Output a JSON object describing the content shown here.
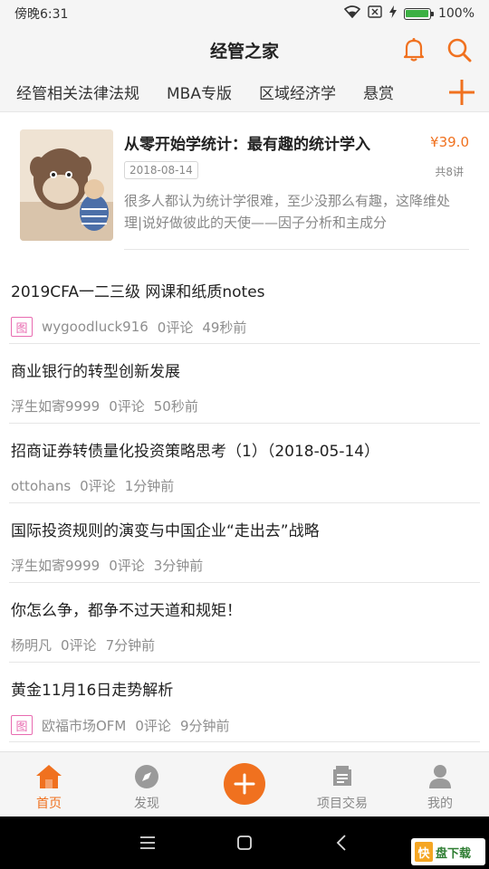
{
  "status_bar": {
    "time": "傍晚6:31",
    "battery": "100%",
    "battery_level": 1.0
  },
  "header": {
    "title": "经管之家",
    "icons": [
      "bell-icon",
      "search-icon"
    ]
  },
  "categories": {
    "items": [
      "经管相关法律法规",
      "MBA专版",
      "区域经济学",
      "悬赏"
    ],
    "add_icon": "plus-icon"
  },
  "featured_course": {
    "title": "从零开始学统计：最有趣的统计学入",
    "price": "¥39.0",
    "date": "2018-08-14",
    "lessons": "共8讲",
    "description": "很多人都认为统计学很难，至少没那么有趣，这降维处理|说好做彼此的天使——因子分析和主成分"
  },
  "articles": [
    {
      "title": "2019CFA一二三级 网课和纸质notes",
      "tag": "图",
      "author": "wygoodluck916",
      "comments": "0评论",
      "time": "49秒前"
    },
    {
      "title": "商业银行的转型创新发展",
      "tag": "",
      "author": "浮生如寄9999",
      "comments": "0评论",
      "time": "50秒前"
    },
    {
      "title": "招商证券转债量化投资策略思考（1）（2018-05-14）",
      "tag": "",
      "author": "ottohans",
      "comments": "0评论",
      "time": "1分钟前"
    },
    {
      "title": "国际投资规则的演变与中国企业“走出去”战略",
      "tag": "",
      "author": "浮生如寄9999",
      "comments": "0评论",
      "time": "3分钟前"
    },
    {
      "title": "你怎么争，都争不过天道和规矩！",
      "tag": "",
      "author": "杨明凡",
      "comments": "0评论",
      "time": "7分钟前"
    },
    {
      "title": "黄金11月16日走势解析",
      "tag": "图",
      "author": "欧福市场OFM",
      "comments": "0评论",
      "time": "9分钟前"
    }
  ],
  "bottom_nav": {
    "items": [
      {
        "label": "首页",
        "icon": "home-icon",
        "active": true
      },
      {
        "label": "发现",
        "icon": "compass-icon",
        "active": false
      },
      {
        "label": "",
        "icon": "plus-fab-icon",
        "active": false
      },
      {
        "label": "项目交易",
        "icon": "document-icon",
        "active": false
      },
      {
        "label": "我的",
        "icon": "user-icon",
        "active": false
      }
    ]
  },
  "watermark": {
    "badge": "快",
    "text": "盘下载"
  },
  "colors": {
    "accent": "#f0711f",
    "tag": "#e86bb0",
    "background": "#f5f5f5"
  }
}
